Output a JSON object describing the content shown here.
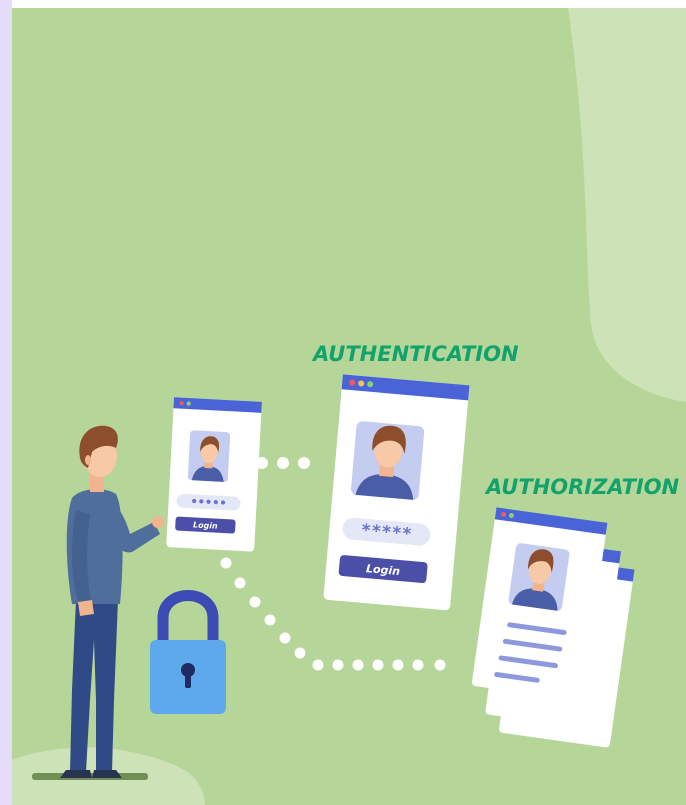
{
  "labels": {
    "authentication": "AUTHENTICATION",
    "authorization": "AUTHORIZATION"
  },
  "small_card": {
    "password_mask": "•••••",
    "button_label": "Login"
  },
  "auth_card": {
    "password_mask": "*****",
    "button_label": "Login"
  },
  "colors": {
    "background": "#b5d599",
    "background_light": "#cde2b6",
    "left_strip": "#e4dcf9",
    "heading": "#11a36b",
    "card_header": "#4a63d6",
    "button": "#4b4fa8",
    "lock_body": "#5ea8ec",
    "lock_shackle": "#3c4cb4"
  },
  "icons": [
    "person-figure",
    "lock-icon",
    "avatar-icon",
    "dotted-connector"
  ]
}
